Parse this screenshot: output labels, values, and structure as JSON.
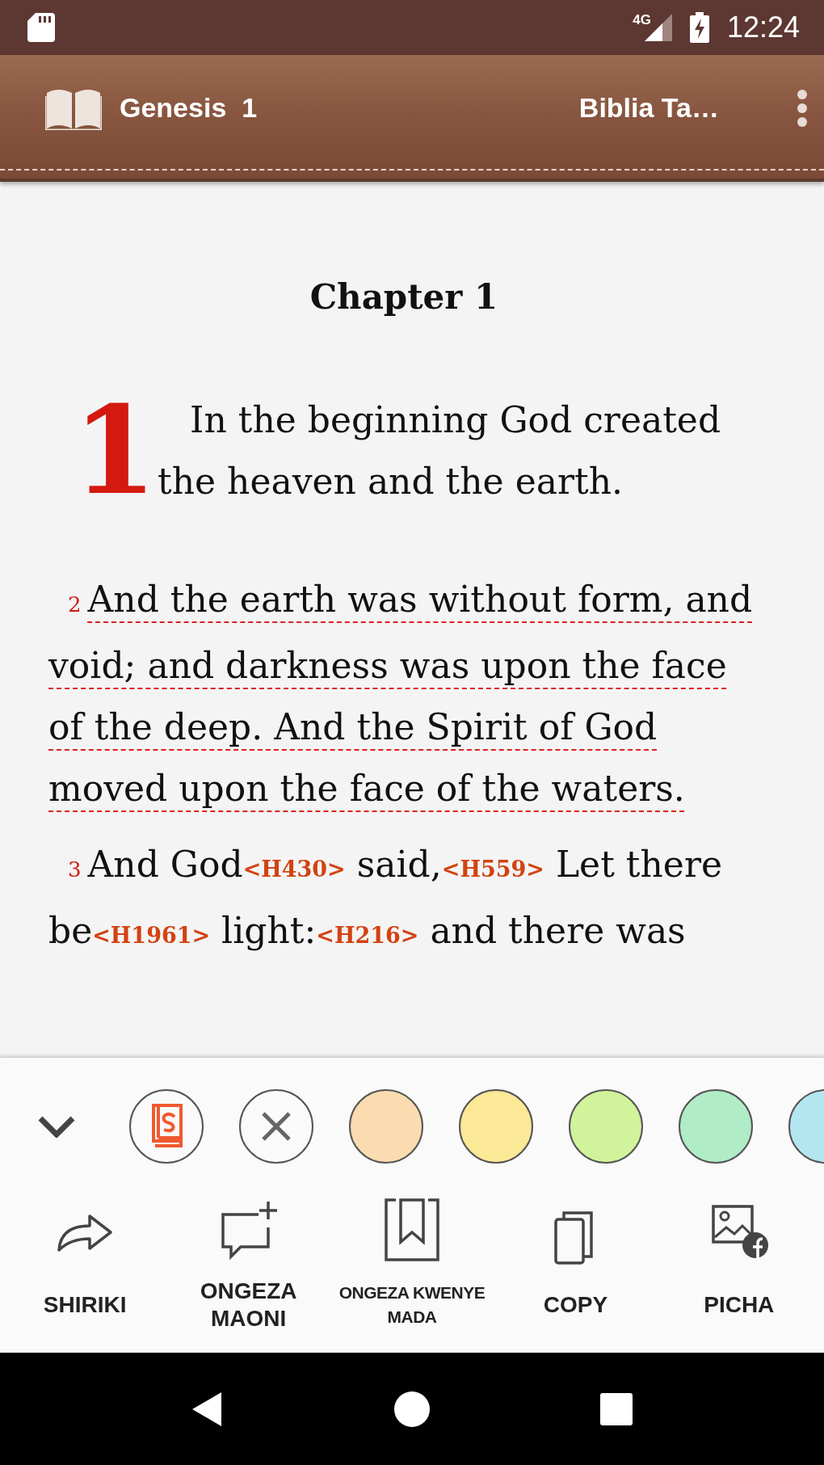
{
  "status_bar": {
    "network": "4G",
    "time": "12:24"
  },
  "toolbar": {
    "title": "Genesis  1",
    "version": "Biblia Ta…"
  },
  "chapter": {
    "heading": "Chapter 1",
    "verses": [
      {
        "kind": "dropcap",
        "number": "1",
        "underlined": false,
        "segments": [
          {
            "text": "In the beginning God created the heaven and the earth.",
            "strong": false
          }
        ]
      },
      {
        "kind": "normal",
        "number": "2",
        "underlined": true,
        "segments": [
          {
            "text": "And the earth was without form, and void; and darkness was upon the face of the deep. And the Spirit of God moved upon the face of the waters.",
            "strong": false
          }
        ]
      },
      {
        "kind": "normal",
        "number": "3",
        "underlined": false,
        "segments": [
          {
            "text": "And God",
            "strong": false
          },
          {
            "text": "<H430>",
            "strong": true
          },
          {
            "text": " said,",
            "strong": false
          },
          {
            "text": "<H559>",
            "strong": true
          },
          {
            "text": " Let there be",
            "strong": false
          },
          {
            "text": "<H1961>",
            "strong": true
          },
          {
            "text": " light:",
            "strong": false
          },
          {
            "text": "<H216>",
            "strong": true
          },
          {
            "text": " and there was",
            "strong": false
          }
        ]
      }
    ]
  },
  "highlight_options": [
    {
      "kind": "style"
    },
    {
      "kind": "clear"
    },
    {
      "kind": "color",
      "color": "#fbdcb0"
    },
    {
      "kind": "color",
      "color": "#fbe997"
    },
    {
      "kind": "color",
      "color": "#d1f39b"
    },
    {
      "kind": "color",
      "color": "#b0ecc6"
    },
    {
      "kind": "color",
      "color": "#b4e6f2"
    }
  ],
  "actions": [
    {
      "kind": "share",
      "label": "SHIRIKI"
    },
    {
      "kind": "note",
      "label": "ONGEZA MAONI"
    },
    {
      "kind": "bookmark",
      "label": "ONGEZA KWENYE MADA"
    },
    {
      "kind": "copy",
      "label": "COPY"
    },
    {
      "kind": "image",
      "label": "PICHA"
    }
  ]
}
